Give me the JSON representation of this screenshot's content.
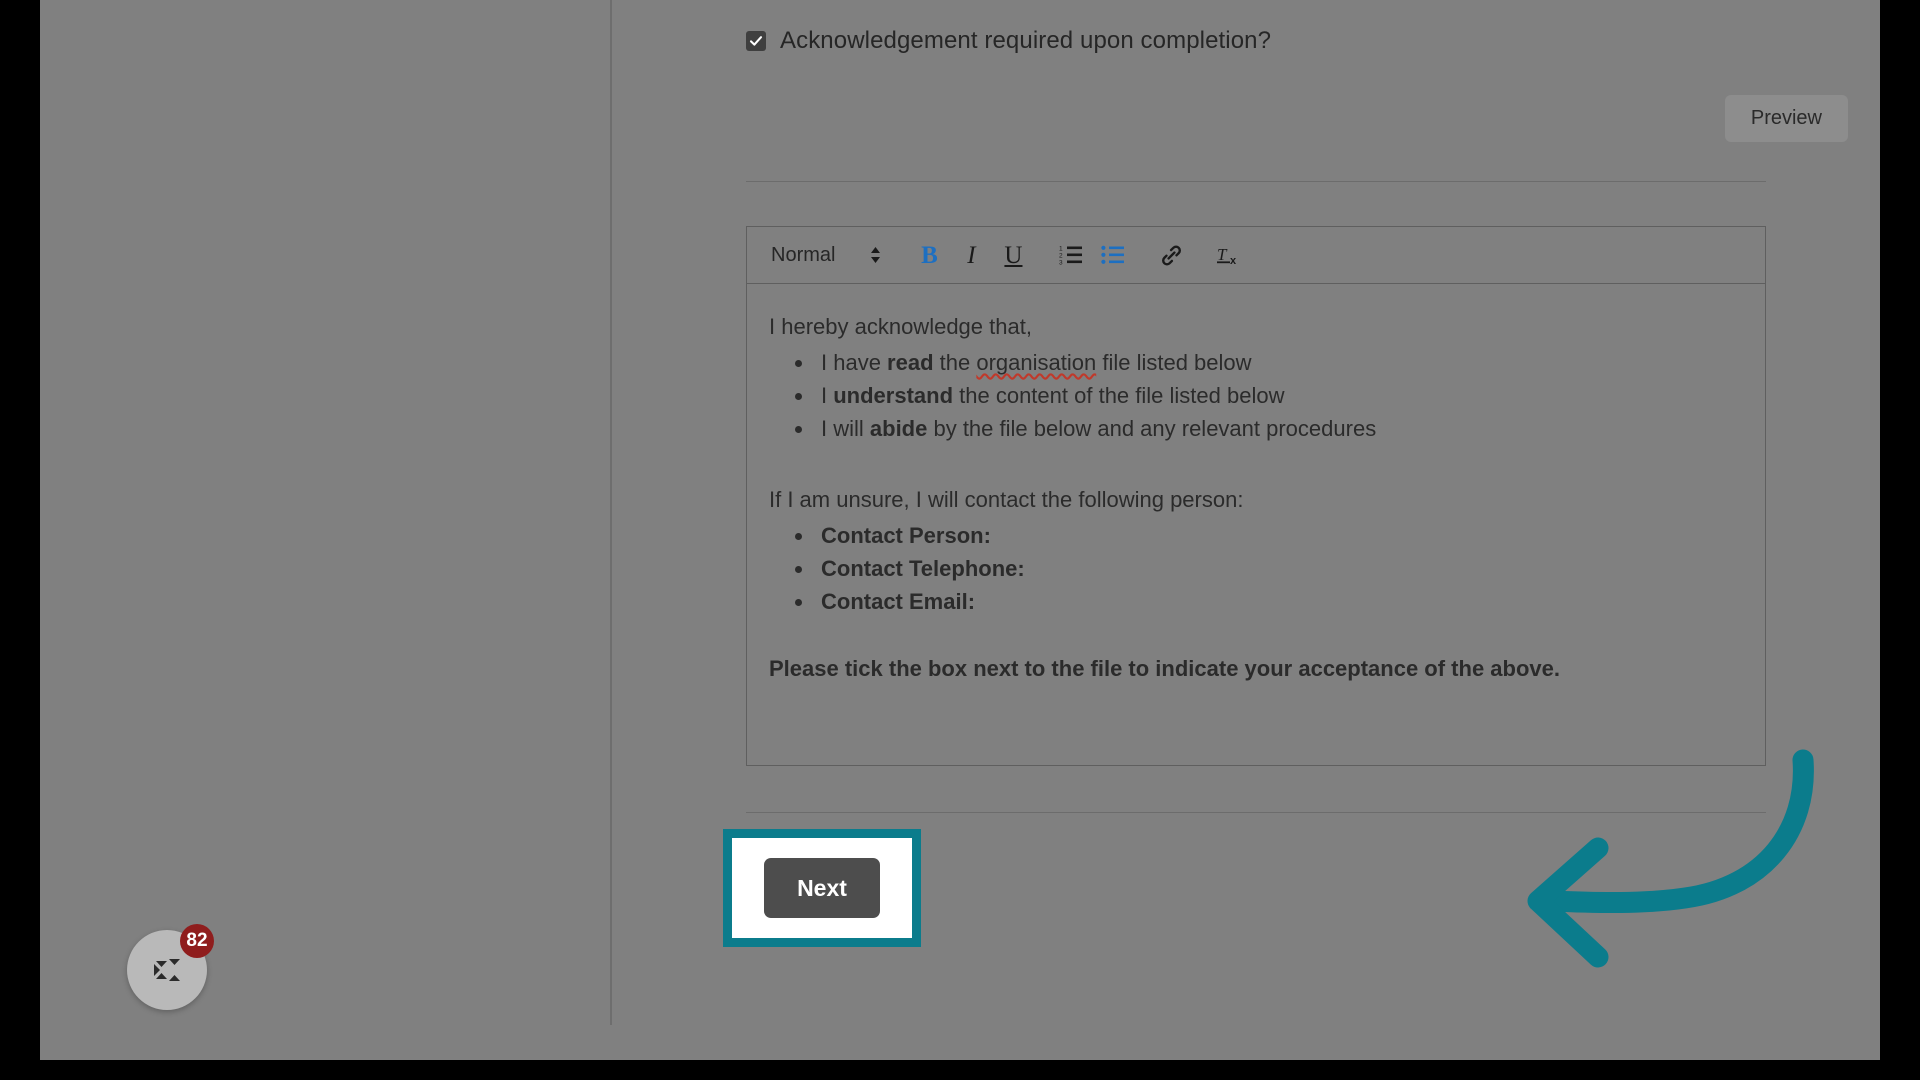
{
  "checkbox_row": {
    "label": "Acknowledgement required upon completion?",
    "checked": true,
    "icon": "check-icon"
  },
  "preview_button": {
    "label": "Preview"
  },
  "editor": {
    "toolbar": {
      "style_select": {
        "value": "Normal",
        "icon": "chevron-updown-icon"
      },
      "buttons": [
        {
          "name": "bold",
          "glyph": "B",
          "icon": "bold-icon",
          "active": true
        },
        {
          "name": "italic",
          "glyph": "I",
          "icon": "italic-icon",
          "active": false
        },
        {
          "name": "underline",
          "glyph": "U",
          "icon": "underline-icon",
          "active": false
        },
        {
          "name": "ordered-list",
          "glyph": "",
          "icon": "ordered-list-icon",
          "active": false
        },
        {
          "name": "bullet-list",
          "glyph": "",
          "icon": "bullet-list-icon",
          "active": true
        },
        {
          "name": "link",
          "glyph": "",
          "icon": "link-icon",
          "active": false
        },
        {
          "name": "clear-format",
          "glyph": "",
          "icon": "clear-format-icon",
          "active": false
        }
      ]
    },
    "document": {
      "intro": "I hereby acknowledge that,",
      "ack_items": [
        {
          "pre": "I have ",
          "bold": "read",
          "post_plain": " the ",
          "misspelled": "organisation",
          "post": " file listed below"
        },
        {
          "pre": "I ",
          "bold": "understand",
          "post_plain": "",
          "misspelled": "",
          "post": " the content of the file listed below"
        },
        {
          "pre": "I will ",
          "bold": "abide",
          "post_plain": "",
          "misspelled": "",
          "post": " by the file below and any relevant procedures"
        }
      ],
      "unsure_line": "If I am unsure, I will contact the following person:",
      "contact_items": [
        "Contact Person:",
        "Contact Telephone:",
        "Contact Email:"
      ],
      "closing": "Please tick the box next to the file to indicate your acceptance of the above."
    }
  },
  "next_button": {
    "label": "Next"
  },
  "annotation": {
    "arrow": {
      "icon": "curved-arrow-left-icon",
      "color": "#0b7c8c"
    },
    "highlight": {
      "color": "#0b7c8c"
    }
  },
  "chat_widget": {
    "icon": "chat-logo-icon",
    "badge_count": "82",
    "badge_color": "#8f1d1d"
  }
}
